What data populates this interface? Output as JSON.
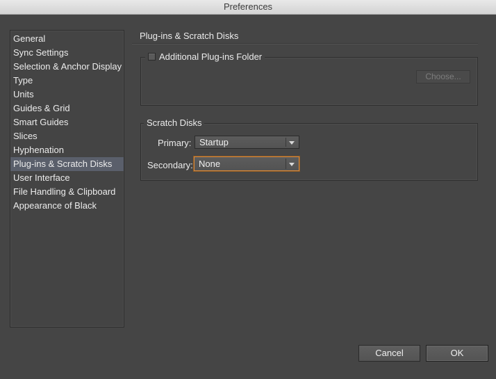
{
  "window": {
    "title": "Preferences"
  },
  "sidebar": {
    "items": [
      {
        "label": "General"
      },
      {
        "label": "Sync Settings"
      },
      {
        "label": "Selection & Anchor Display"
      },
      {
        "label": "Type"
      },
      {
        "label": "Units"
      },
      {
        "label": "Guides & Grid"
      },
      {
        "label": "Smart Guides"
      },
      {
        "label": "Slices"
      },
      {
        "label": "Hyphenation"
      },
      {
        "label": "Plug-ins & Scratch Disks"
      },
      {
        "label": "User Interface"
      },
      {
        "label": "File Handling & Clipboard"
      },
      {
        "label": "Appearance of Black"
      }
    ],
    "selected_label": "Plug-ins & Scratch Disks"
  },
  "panel": {
    "title": "Plug-ins & Scratch Disks",
    "plugins_group": {
      "checkbox_label": "Additional Plug-ins Folder",
      "checked": false,
      "choose_label": "Choose..."
    },
    "scratch_group": {
      "title": "Scratch Disks",
      "primary_label": "Primary:",
      "primary_value": "Startup",
      "secondary_label": "Secondary:",
      "secondary_value": "None"
    }
  },
  "footer": {
    "cancel_label": "Cancel",
    "ok_label": "OK"
  },
  "colors": {
    "background": "#454545",
    "selection": "#5a5f6b",
    "focus_ring": "#d98a3c"
  }
}
